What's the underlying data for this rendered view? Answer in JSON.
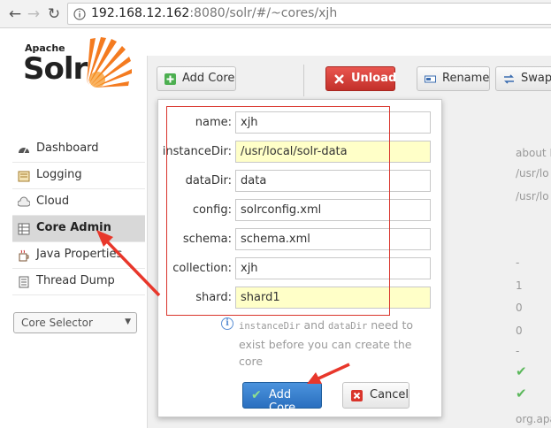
{
  "browser": {
    "url_host": "192.168.12.162",
    "url_rest": ":8080/solr/#/~cores/xjh"
  },
  "logo": {
    "top": "Apache",
    "main": "Solr"
  },
  "sidebar": {
    "items": [
      {
        "label": "Dashboard",
        "icon": "dashboard-icon"
      },
      {
        "label": "Logging",
        "icon": "logging-icon"
      },
      {
        "label": "Cloud",
        "icon": "cloud-icon"
      },
      {
        "label": "Core Admin",
        "icon": "core-admin-icon",
        "active": true
      },
      {
        "label": "Java Properties",
        "icon": "java-icon"
      },
      {
        "label": "Thread Dump",
        "icon": "thread-dump-icon"
      }
    ],
    "core_selector": "Core Selector"
  },
  "toolbar": {
    "add_core": "Add Core",
    "unload": "Unload",
    "rename": "Rename",
    "swap": "Swap"
  },
  "background": {
    "about": "about I",
    "path1": "/usr/lo",
    "path2": "/usr/lo",
    "dash": "-",
    "one": "1",
    "zero1": "0",
    "zero2": "0",
    "dash2": "-",
    "org": "org.apa"
  },
  "form": {
    "name": {
      "label": "name:",
      "value": "xjh"
    },
    "instanceDir": {
      "label": "instanceDir:",
      "value": "/usr/local/solr-data"
    },
    "dataDir": {
      "label": "dataDir:",
      "value": "data"
    },
    "config": {
      "label": "config:",
      "value": "solrconfig.xml"
    },
    "schema": {
      "label": "schema:",
      "value": "schema.xml"
    },
    "collection": {
      "label": "collection:",
      "value": "xjh"
    },
    "shard": {
      "label": "shard:",
      "value": "shard1"
    },
    "info_code1": "instanceDir",
    "info_and": " and ",
    "info_code2": "dataDir",
    "info_rest": " need to exist before you can create the core",
    "submit": "Add Core",
    "cancel": "Cancel"
  },
  "colors": {
    "unload": "#c3302a",
    "submit": "#2a6fbf",
    "highlight": "#d9342b",
    "arrow": "#e8372b"
  }
}
